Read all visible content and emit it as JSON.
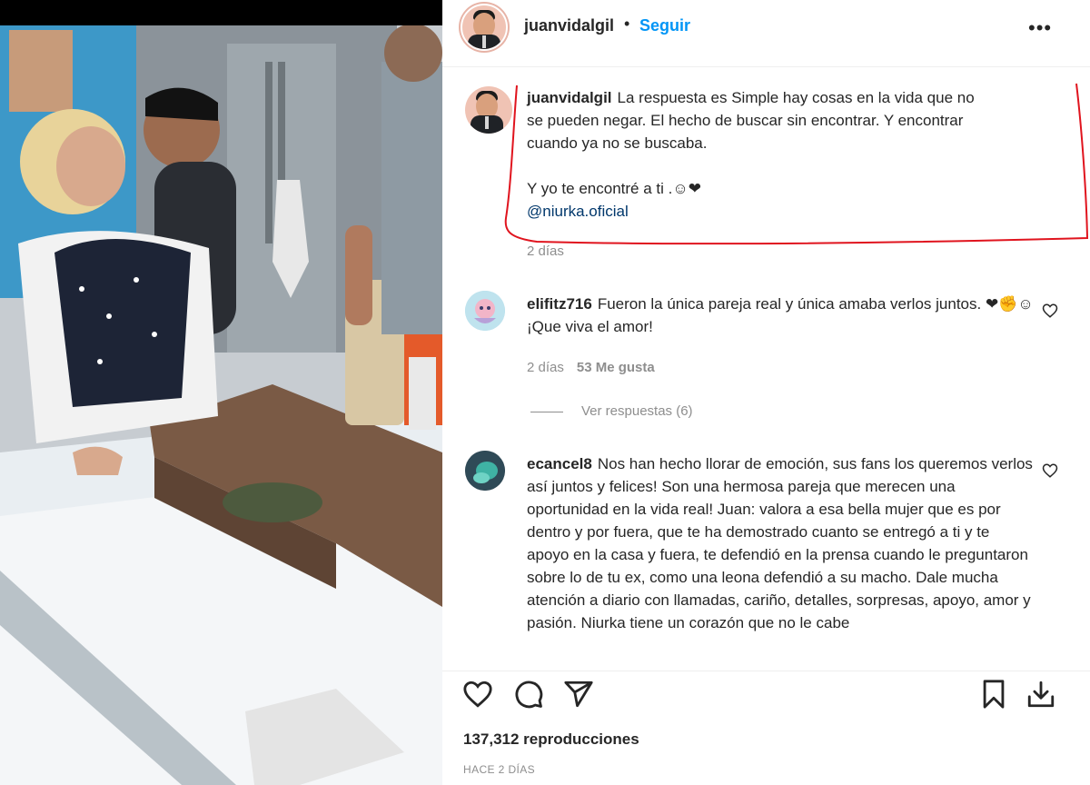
{
  "post": {
    "username": "juanvidalgil",
    "dot": "•",
    "follow_label": "Seguir",
    "more_label": "•••"
  },
  "caption": {
    "username": "juanvidalgil",
    "text_lines": [
      "La respuesta es Simple hay cosas en la vida que no",
      "se pueden negar. El hecho de buscar sin encontrar. Y encontrar",
      "cuando ya no se buscaba."
    ],
    "second_line": "Y yo te encontré a ti .☺❤",
    "mention": "@niurka.oficial",
    "time": "2 días"
  },
  "comments": [
    {
      "username": "elifitz716",
      "text": "Fueron la única pareja real y única amaba verlos juntos. ❤✊☺ ¡Que viva el amor!",
      "time": "2 días",
      "likes": "53 Me gusta",
      "replies": "Ver respuestas (6)"
    },
    {
      "username": "ecancel8",
      "text": "Nos han hecho llorar de emoción, sus fans los queremos verlos así juntos y felices! Son una hermosa pareja que merecen una oportunidad en la vida real! Juan: valora a esa bella mujer que es por dentro y por fuera, que te ha demostrado cuanto se entregó a ti y te apoyo en la casa y fuera, te defendió en la prensa cuando le preguntaron sobre lo de tu ex, como una leona defendió a su macho. Dale mucha atención a diario con llamadas, cariño, detalles, sorpresas, apoyo, amor y pasión. Niurka tiene un corazón que no le cabe"
    }
  ],
  "icons": {
    "like": "heart-icon",
    "comment": "comment-icon",
    "share": "share-icon",
    "save": "bookmark-icon",
    "download": "download-icon"
  },
  "stats": {
    "views": "137,312 reproducciones",
    "posted": "HACE 2 DÍAS"
  },
  "colors": {
    "accent": "#0095f6",
    "highlight_stroke": "#e0141e",
    "mention": "#00376b",
    "muted": "#8e8e8e"
  }
}
